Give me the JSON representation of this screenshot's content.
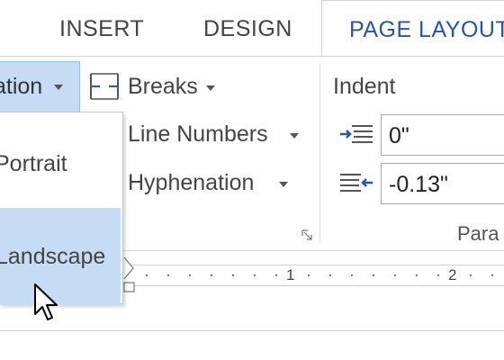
{
  "tabs": {
    "insert": "INSERT",
    "design": "DESIGN",
    "page_layout": "PAGE LAYOUT"
  },
  "page_setup": {
    "orientation_label": "ation",
    "breaks_label": "Breaks",
    "line_numbers_label": "Line Numbers",
    "hyphenation_label": "Hyphenation"
  },
  "paragraph": {
    "indent_title": "Indent",
    "left_value": "0\"",
    "right_value": "-0.13\"",
    "group_label": "Para"
  },
  "orientation_menu": {
    "items": [
      {
        "label": "Portrait",
        "selected": false
      },
      {
        "label": "Landscape",
        "selected": true
      }
    ]
  },
  "ruler": {
    "numbers": [
      "1",
      "2"
    ]
  },
  "colors": {
    "accent": "#2b579a",
    "highlight": "#c5dcf4"
  },
  "icons": [
    "dropdown-caret-icon",
    "breaks-icon",
    "indent-left-icon",
    "indent-right-icon",
    "dialog-launcher-icon",
    "mouse-pointer-icon"
  ]
}
